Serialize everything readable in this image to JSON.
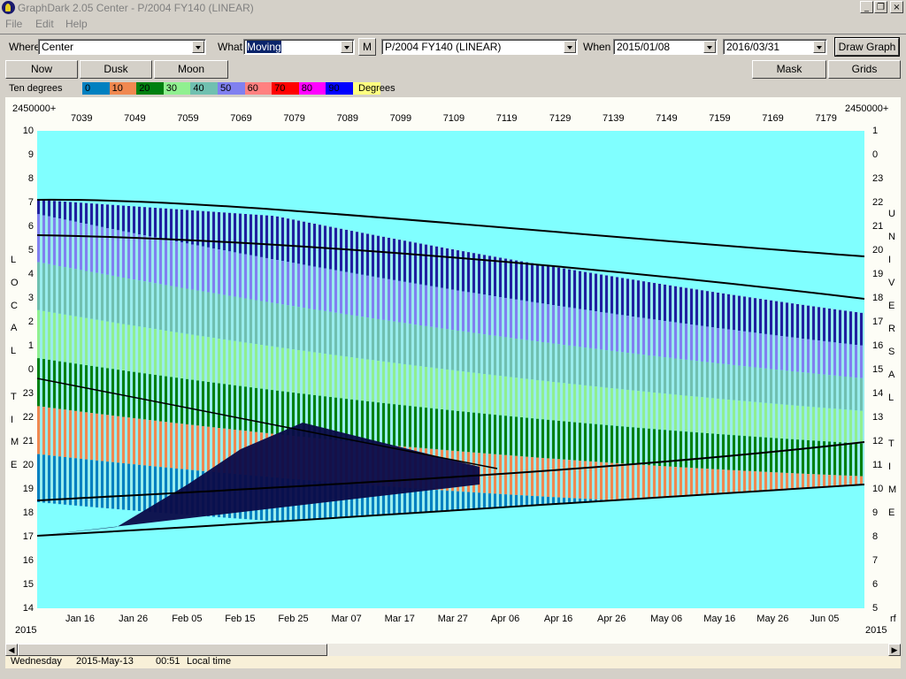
{
  "window": {
    "title": "GraphDark 2.05  Center  -  P/2004 FY140 (LINEAR)",
    "btn_min": "_",
    "btn_restore": "❐",
    "btn_close": "×"
  },
  "menu": [
    "File",
    "Edit",
    "Help"
  ],
  "toolbar": {
    "where_label": "Where",
    "where_value": "Center",
    "what_label": "What",
    "what_value": "Moving",
    "m_button": "M",
    "object_value": "P/2004 FY140 (LINEAR)",
    "when_label": "When",
    "date_from": "2015/01/08",
    "date_to": "2016/03/31",
    "draw_button": "Draw Graph"
  },
  "toolbar2": {
    "now": "Now",
    "dusk": "Dusk",
    "moon": "Moon",
    "mask": "Mask",
    "grids": "Grids"
  },
  "legend": {
    "label": "Ten degrees",
    "unit": "Degrees",
    "items": [
      {
        "text": "0",
        "color": "#0080c0"
      },
      {
        "text": "10",
        "color": "#f08850"
      },
      {
        "text": "20",
        "color": "#008010"
      },
      {
        "text": "30",
        "color": "#90f090"
      },
      {
        "text": "40",
        "color": "#70c0b0"
      },
      {
        "text": "50",
        "color": "#8080f0"
      },
      {
        "text": "60",
        "color": "#ff8080"
      },
      {
        "text": "70",
        "color": "#ff0000"
      },
      {
        "text": "80",
        "color": "#ff00ff"
      },
      {
        "text": "90",
        "color": "#0000ff"
      },
      {
        "text": "",
        "color": "#ffff80"
      }
    ]
  },
  "graph": {
    "jd_prefix_left": "2450000+",
    "jd_prefix_right": "2450000+",
    "jd_ticks": [
      "7039",
      "7049",
      "7059",
      "7069",
      "7079",
      "7089",
      "7099",
      "7109",
      "7119",
      "7129",
      "7139",
      "7149",
      "7159",
      "7169",
      "7179"
    ],
    "date_ticks": [
      "Jan 16",
      "Jan 26",
      "Feb 05",
      "Feb 15",
      "Feb 25",
      "Mar 07",
      "Mar 17",
      "Mar 27",
      "Apr 06",
      "Apr 16",
      "Apr 26",
      "May 06",
      "May 16",
      "May 26",
      "Jun 05"
    ],
    "year_left": "2015",
    "year_right": "2015",
    "rf_label": "rf",
    "left_hours": [
      "10",
      "9",
      "8",
      "7",
      "6",
      "5",
      "4",
      "3",
      "2",
      "1",
      "0",
      "23",
      "22",
      "21",
      "20",
      "19",
      "18",
      "17",
      "16",
      "15",
      "14"
    ],
    "right_hours": [
      "1",
      "0",
      "23",
      "22",
      "21",
      "20",
      "19",
      "18",
      "17",
      "16",
      "15",
      "14",
      "13",
      "12",
      "11",
      "10",
      "9",
      "8",
      "7",
      "6",
      "5"
    ],
    "left_axis_letters": [
      "L",
      "O",
      "C",
      "A",
      "L",
      "",
      "T",
      "I",
      "M",
      "E"
    ],
    "right_axis_letters": [
      "U",
      "N",
      "I",
      "V",
      "E",
      "R",
      "S",
      "A",
      "L",
      "",
      "T",
      "I",
      "M",
      "E"
    ],
    "colors": {
      "sky": "#80ffff",
      "night": "#0a0a48",
      "grey": "#c8c8cc",
      "navy": "#2020a0"
    }
  },
  "status": {
    "day": "Wednesday",
    "date": "2015-May-13",
    "time": "00:51",
    "mode": "Local time"
  }
}
